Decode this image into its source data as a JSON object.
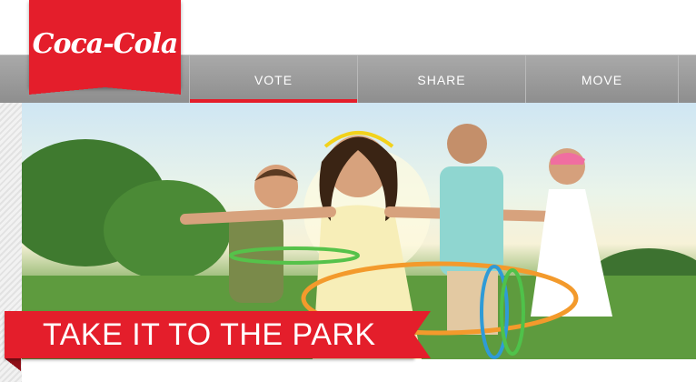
{
  "brand": {
    "logo_text": "Coca-Cola",
    "color": "#e41e2b"
  },
  "nav": {
    "tabs": [
      {
        "label": "VOTE",
        "active": true
      },
      {
        "label": "SHARE",
        "active": false
      },
      {
        "label": "MOVE",
        "active": false
      }
    ]
  },
  "hero": {
    "banner_text": "TAKE IT TO THE PARK"
  },
  "colors": {
    "nav_bg": "#999999",
    "accent": "#e41e2b"
  }
}
